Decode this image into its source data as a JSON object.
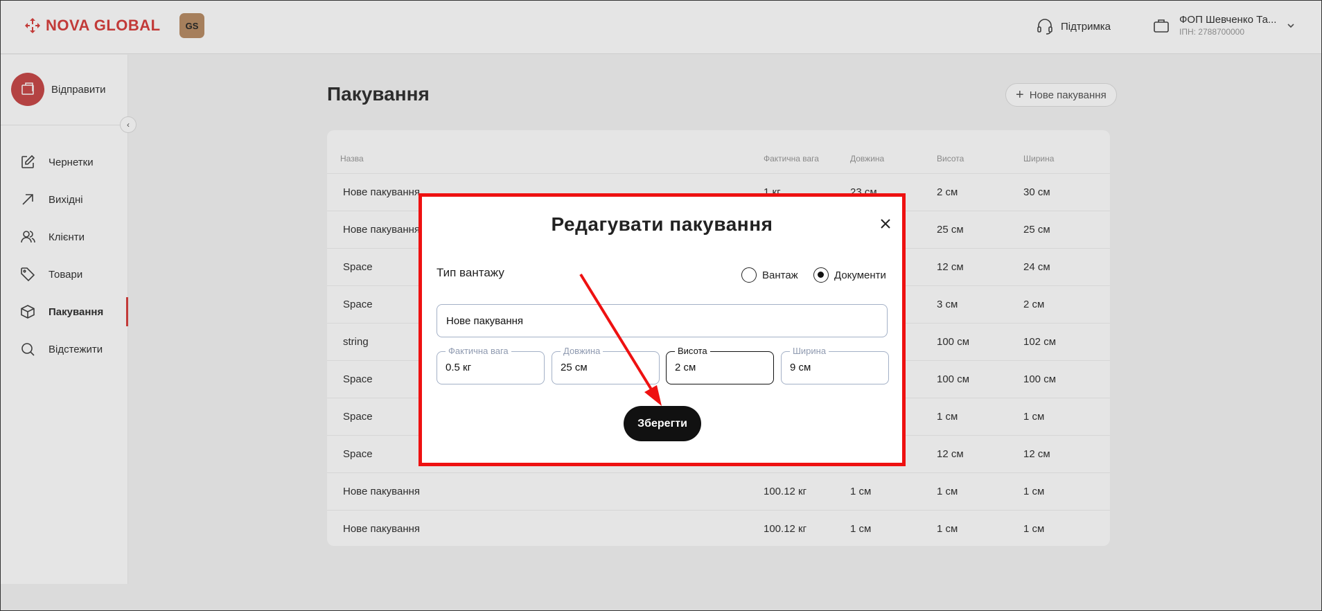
{
  "brand": {
    "name": "NOVA GLOBAL",
    "badge": "GS",
    "color": "#d9413f"
  },
  "header": {
    "support_label": "Підтримка",
    "account_name": "ФОП Шевченко Та...",
    "account_inn": "ІПН: 2788700000"
  },
  "sidebar": {
    "send_label": "Відправити",
    "items": [
      {
        "label": "Чернетки",
        "icon": "edit-icon"
      },
      {
        "label": "Вихідні",
        "icon": "arrow-up-right-icon"
      },
      {
        "label": "Клієнти",
        "icon": "users-icon"
      },
      {
        "label": "Товари",
        "icon": "tag-icon"
      },
      {
        "label": "Пакування",
        "icon": "box-icon",
        "active": true
      },
      {
        "label": "Відстежити",
        "icon": "search-icon"
      }
    ]
  },
  "main": {
    "title": "Пакування",
    "new_button": "Нове пакування",
    "columns": [
      "Назва",
      "Фактична вага",
      "Довжина",
      "Висота",
      "Ширина"
    ],
    "rows": [
      [
        "Нове пакування",
        "1 кг",
        "23 см",
        "2 см",
        "30 см"
      ],
      [
        "Нове пакування",
        "",
        "",
        "25 см",
        "25 см"
      ],
      [
        "Space",
        "",
        "",
        "12 см",
        "24 см"
      ],
      [
        "Space",
        "",
        "",
        "3 см",
        "2 см"
      ],
      [
        "string",
        "",
        "",
        "100 см",
        "102 см"
      ],
      [
        "Space",
        "",
        "",
        "100 см",
        "100 см"
      ],
      [
        "Space",
        "",
        "",
        "1 см",
        "1 см"
      ],
      [
        "Space",
        "",
        "",
        "12 см",
        "12 см"
      ],
      [
        "Нове пакування",
        "100.12 кг",
        "1 см",
        "1 см",
        "1 см"
      ],
      [
        "Нове пакування",
        "100.12 кг",
        "1 см",
        "1 см",
        "1 см"
      ]
    ]
  },
  "modal": {
    "title": "Редагувати пакування",
    "cargo_type_label": "Тип вантажу",
    "options": [
      {
        "label": "Вантаж",
        "checked": false
      },
      {
        "label": "Документи",
        "checked": true
      }
    ],
    "name_value": "Нове пакування",
    "fields": [
      {
        "label": "Фактична вага",
        "value": "0.5 кг"
      },
      {
        "label": "Довжина",
        "value": "25 см"
      },
      {
        "label": "Висота",
        "value": "2 см",
        "focused": true
      },
      {
        "label": "Ширина",
        "value": "9 см"
      }
    ],
    "save_label": "Зберегти"
  }
}
